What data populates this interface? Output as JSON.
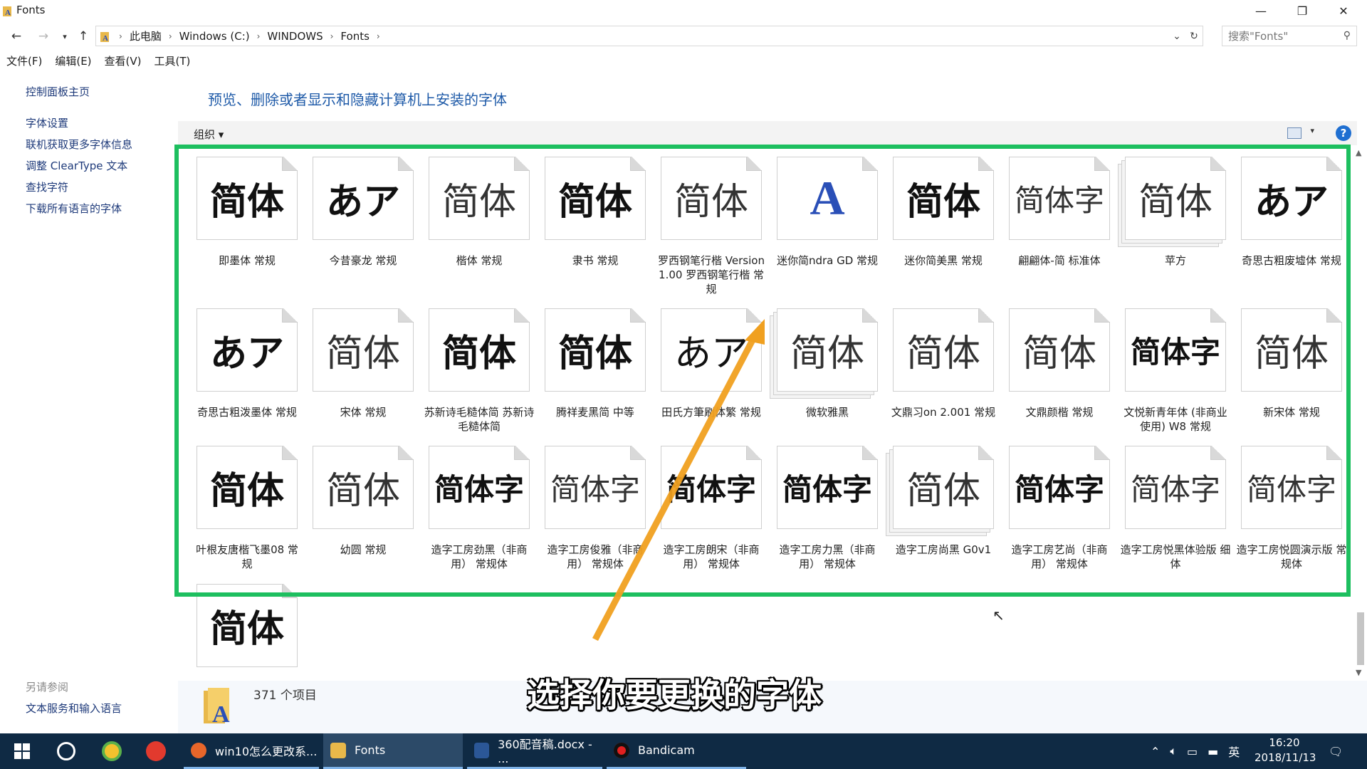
{
  "window": {
    "title": "Fonts"
  },
  "address": {
    "crumbs": [
      "此电脑",
      "Windows (C:)",
      "WINDOWS",
      "Fonts"
    ],
    "search_placeholder": "搜索\"Fonts\""
  },
  "menu": [
    "文件(F)",
    "编辑(E)",
    "查看(V)",
    "工具(T)"
  ],
  "sidebar": {
    "home": "控制面板主页",
    "links": [
      "字体设置",
      "联机获取更多字体信息",
      "调整 ClearType 文本",
      "查找字符",
      "下载所有语言的字体"
    ],
    "see_also_title": "另请参阅",
    "see_also_link": "文本服务和输入语言"
  },
  "content": {
    "header": "预览、删除或者显示和隐藏计算机上安装的字体",
    "organize_label": "组织 ▾",
    "help": "?"
  },
  "fonts": [
    {
      "sample": "简体",
      "label": "即墨体 常规"
    },
    {
      "sample": "あア",
      "label": "今昔豪龙 常规"
    },
    {
      "sample": "简体",
      "label": "楷体 常规"
    },
    {
      "sample": "简体",
      "label": "隶书 常规"
    },
    {
      "sample": "简体",
      "label": "罗西钢笔行楷 Version 1.00 罗西钢笔行楷 常规"
    },
    {
      "sample": "A",
      "label": "迷你简ndra GD 常规"
    },
    {
      "sample": "简体",
      "label": "迷你简美黑 常规"
    },
    {
      "sample": "简体字",
      "label": "翩翩体-简 标准体"
    },
    {
      "sample": "简体",
      "label": "苹方"
    },
    {
      "sample": "あア",
      "label": "奇思古粗废墟体 常规"
    },
    {
      "sample": "あア",
      "label": "奇思古粗泼墨体 常规"
    },
    {
      "sample": "简体",
      "label": "宋体 常规"
    },
    {
      "sample": "简体",
      "label": "苏新诗毛糙体简 苏新诗毛糙体简"
    },
    {
      "sample": "简体",
      "label": "腾祥麦黑简 中等"
    },
    {
      "sample": "あア",
      "label": "田氏方筆刷体繁 常规"
    },
    {
      "sample": "简体",
      "label": "微软雅黑"
    },
    {
      "sample": "简体",
      "label": "文鼎习on 2.001 常规"
    },
    {
      "sample": "简体",
      "label": "文鼎颜楷 常规"
    },
    {
      "sample": "简体字",
      "label": "文悦新青年体 (非商业使用) W8 常规"
    },
    {
      "sample": "简体",
      "label": "新宋体 常规"
    },
    {
      "sample": "简体",
      "label": "叶根友唐楷飞墨08 常规"
    },
    {
      "sample": "简体",
      "label": "幼圆 常规"
    },
    {
      "sample": "简体字",
      "label": "造字工房劲黑（非商用） 常规体"
    },
    {
      "sample": "简体字",
      "label": "造字工房俊雅（非商用） 常规体"
    },
    {
      "sample": "简体字",
      "label": "造字工房朗宋（非商用） 常规体"
    },
    {
      "sample": "简体字",
      "label": "造字工房力黑（非商用） 常规体"
    },
    {
      "sample": "简体",
      "label": "造字工房尚黑 G0v1"
    },
    {
      "sample": "简体字",
      "label": "造字工房艺尚（非商用） 常规体"
    },
    {
      "sample": "简体字",
      "label": "造字工房悦黑体验版 细体"
    },
    {
      "sample": "简体字",
      "label": "造字工房悦圆演示版 常规体"
    },
    {
      "sample": "简体",
      "label": ""
    }
  ],
  "status": {
    "count": "371 个项目"
  },
  "overlay": {
    "subtitle": "选择你要更换的字体"
  },
  "taskbar": {
    "tasks": [
      "win10怎么更改系...",
      "Fonts",
      "360配音稿.docx - ...",
      "Bandicam"
    ],
    "ime": "英",
    "time": "16:20",
    "date": "2018/11/13"
  },
  "colors": {
    "selection": "#1dbf5f",
    "arrow": "#f0a020",
    "link": "#1e5aa8"
  }
}
